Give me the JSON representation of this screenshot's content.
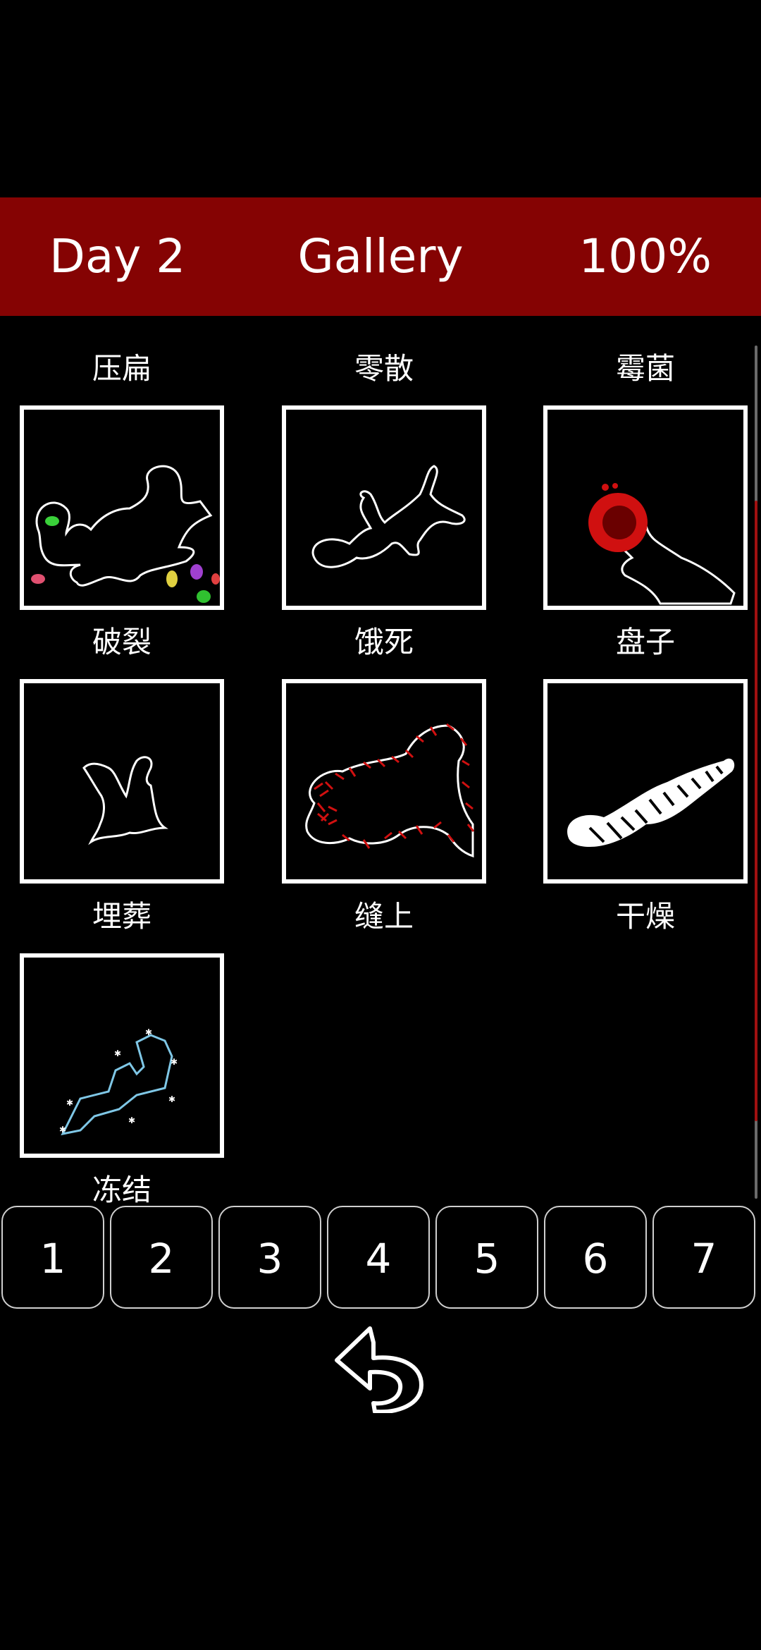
{
  "header": {
    "day": "Day 2",
    "title": "Gallery",
    "completion": "100%"
  },
  "gallery": {
    "items": [
      {
        "label": "压扁",
        "art": "flattened-body"
      },
      {
        "label": "零散",
        "art": "scattered-body"
      },
      {
        "label": "霉菌",
        "art": "mold-body"
      },
      {
        "label": "破裂",
        "art": "broken-body"
      },
      {
        "label": "饿死",
        "art": "starved-body"
      },
      {
        "label": "盘子",
        "art": "plate-body"
      },
      {
        "label": "埋葬",
        "art": "buried-body"
      },
      {
        "label": "缝上",
        "art": "stitched-body"
      },
      {
        "label": "干燥",
        "art": "dried-body"
      },
      {
        "label": "冻结",
        "art": "frozen-body"
      }
    ]
  },
  "pager": {
    "pages": [
      "1",
      "2",
      "3",
      "4",
      "5",
      "6",
      "7"
    ]
  },
  "colors": {
    "header_bg": "#850303",
    "background": "#000000",
    "frame": "#ffffff",
    "accent_red": "#c01010",
    "ice_blue": "#7fc7e6"
  },
  "icons": {
    "back": "undo-arrow-icon"
  }
}
